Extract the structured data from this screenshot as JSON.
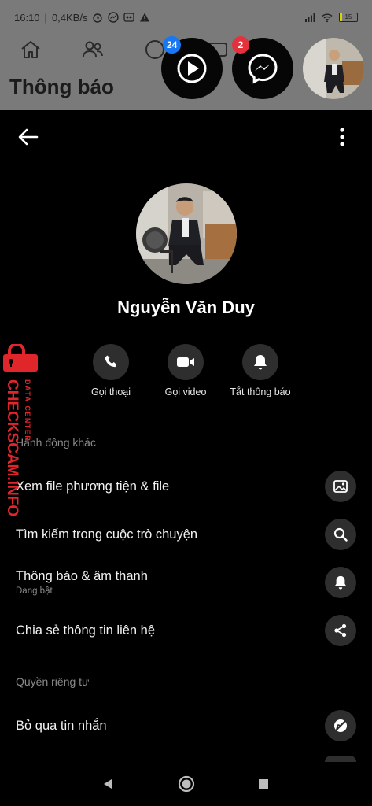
{
  "status_bar": {
    "time": "16:10",
    "net_speed": "0,4KB/s",
    "battery_level": "15"
  },
  "background": {
    "page_title": "Thông báo"
  },
  "chat_heads": {
    "video_badge": "24",
    "messenger_badge": "2"
  },
  "profile": {
    "name": "Nguyễn Văn Duy"
  },
  "actions": [
    {
      "label": "Gọi thoại",
      "icon": "phone-icon"
    },
    {
      "label": "Gọi video",
      "icon": "video-camera-icon"
    },
    {
      "label": "Tắt thông báo",
      "icon": "bell-icon"
    }
  ],
  "sections": {
    "other_actions": "Hành động khác",
    "privacy": "Quyền riêng tư"
  },
  "rows": [
    {
      "label": "Xem file phương tiện & file",
      "sub": "",
      "icon": "image-icon"
    },
    {
      "label": "Tìm kiếm trong cuộc trò chuyện",
      "sub": "",
      "icon": "search-icon"
    },
    {
      "label": "Thông báo & âm thanh",
      "sub": "Đang bật",
      "icon": "bell-icon"
    },
    {
      "label": "Chia sẻ thông tin liên hệ",
      "sub": "",
      "icon": "share-icon"
    },
    {
      "label": "Bỏ qua tin nhắn",
      "sub": "",
      "icon": "ignore-icon"
    }
  ],
  "watermark": {
    "brand": "CHECKSCAM.INFO",
    "tagline": "DATA CENTER"
  },
  "colors": {
    "sheet_bg": "#000000",
    "button_bg": "#2e2e2e",
    "muted_text": "#8a8a8a",
    "watermark_red": "#e0262b",
    "badge_blue": "#1877f2",
    "badge_red": "#e4313c"
  }
}
